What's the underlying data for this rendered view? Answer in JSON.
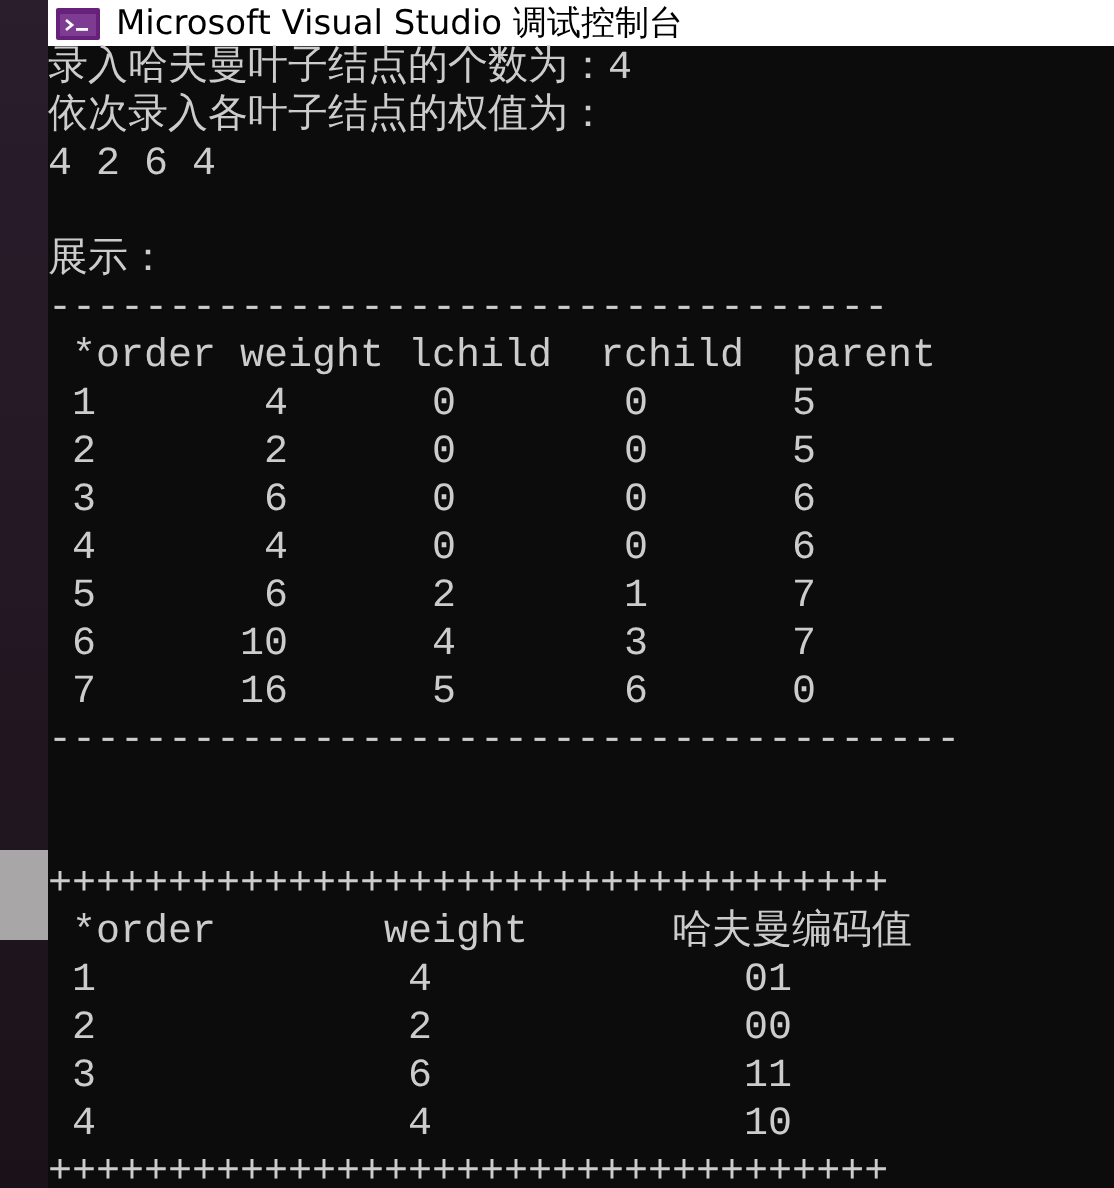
{
  "window": {
    "title": "Microsoft Visual Studio 调试控制台"
  },
  "prompt_lines": [
    "录入哈夫曼叶子结点的个数为：4",
    "依次录入各叶子结点的权值为：",
    "4 2 6 4"
  ],
  "section_label": "展示：",
  "tree_table": {
    "rule_top": "-----------------------------------",
    "columns": [
      "*order",
      "weight",
      "lchild",
      "rchild",
      "parent"
    ],
    "rows": [
      [
        "1",
        "4",
        "0",
        "0",
        "5"
      ],
      [
        "2",
        "2",
        "0",
        "0",
        "5"
      ],
      [
        "3",
        "6",
        "0",
        "0",
        "6"
      ],
      [
        "4",
        "4",
        "0",
        "0",
        "6"
      ],
      [
        "5",
        "6",
        "2",
        "1",
        "7"
      ],
      [
        "6",
        "10",
        "4",
        "3",
        "7"
      ],
      [
        "7",
        "16",
        "5",
        "6",
        "0"
      ]
    ],
    "rule_bottom": "--------------------------------------"
  },
  "code_table": {
    "rule_top": "+++++++++++++++++++++++++++++++++++",
    "columns": [
      "*order",
      "weight",
      "哈夫曼编码值"
    ],
    "rows": [
      [
        "1",
        "4",
        "01"
      ],
      [
        "2",
        "2",
        "00"
      ],
      [
        "3",
        "6",
        "11"
      ],
      [
        "4",
        "4",
        "10"
      ]
    ],
    "rule_bottom": "+++++++++++++++++++++++++++++++++++"
  }
}
